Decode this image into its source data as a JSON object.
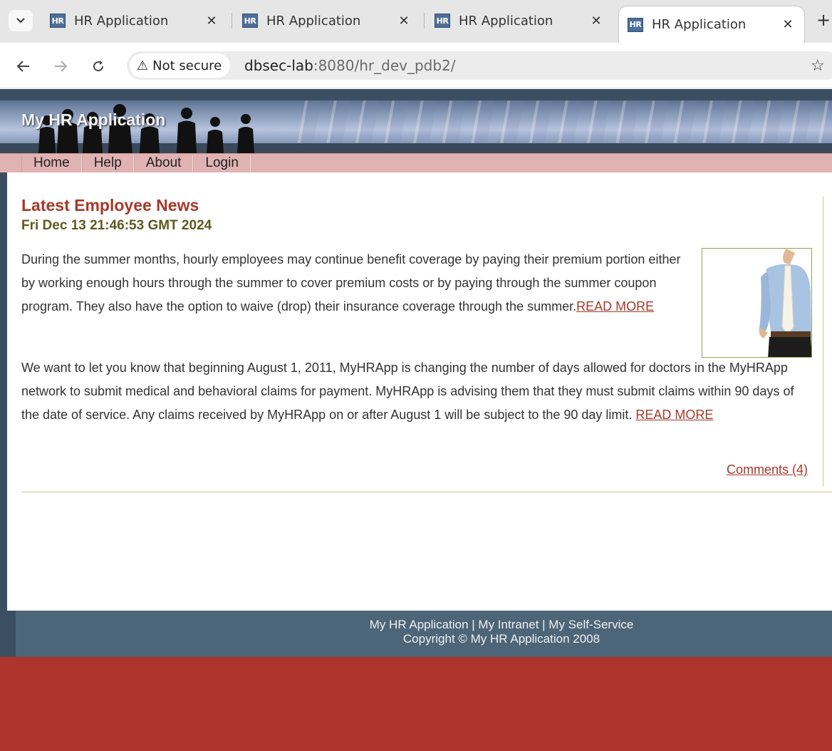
{
  "browser": {
    "tabs": [
      {
        "favicon": "HR",
        "title": "HR Application",
        "active": false
      },
      {
        "favicon": "HR",
        "title": "HR Application",
        "active": false
      },
      {
        "favicon": "HR",
        "title": "HR Application",
        "active": false
      },
      {
        "favicon": "HR",
        "title": "HR Application",
        "active": true
      }
    ],
    "security_label": "Not secure",
    "url_host": "dbsec-lab",
    "url_rest": ":8080/hr_dev_pdb2/"
  },
  "site": {
    "banner_title": "My HR Application",
    "menu": [
      "Home",
      "Help",
      "About",
      "Login"
    ]
  },
  "news": {
    "title": "Latest Employee News",
    "date": "Fri Dec 13 21:46:53 GMT 2024",
    "paragraph1": "During the summer months, hourly employees may continue benefit coverage by paying their premium portion either by working enough hours through the summer to cover premium costs or by paying through the summer coupon program. They also have the option to waive (drop) their insurance coverage through the summer.",
    "paragraph1_link": "READ MORE",
    "paragraph2": "We want to let you know that beginning August 1, 2011, MyHRApp is changing the number of days allowed for doctors in the MyHRApp network to submit medical and behavioral claims for payment.  MyHRApp is advising them that they must submit claims within 90 days of the date of service.  Any claims received by MyHRApp on or after August 1 will be subject to the 90 day limit. ",
    "paragraph2_link": "READ MORE",
    "comments_link": "Comments (4)"
  },
  "footer": {
    "links_line": "My HR Application | My Intranet | My Self-Service",
    "copyright": "Copyright © My HR Application 2008"
  },
  "colors": {
    "accent_red": "#a6392b",
    "date_olive": "#5d5a1e",
    "menu_pink": "#e0b3b2",
    "page_red": "#ad352e",
    "frame_slate": "#4d6579"
  }
}
